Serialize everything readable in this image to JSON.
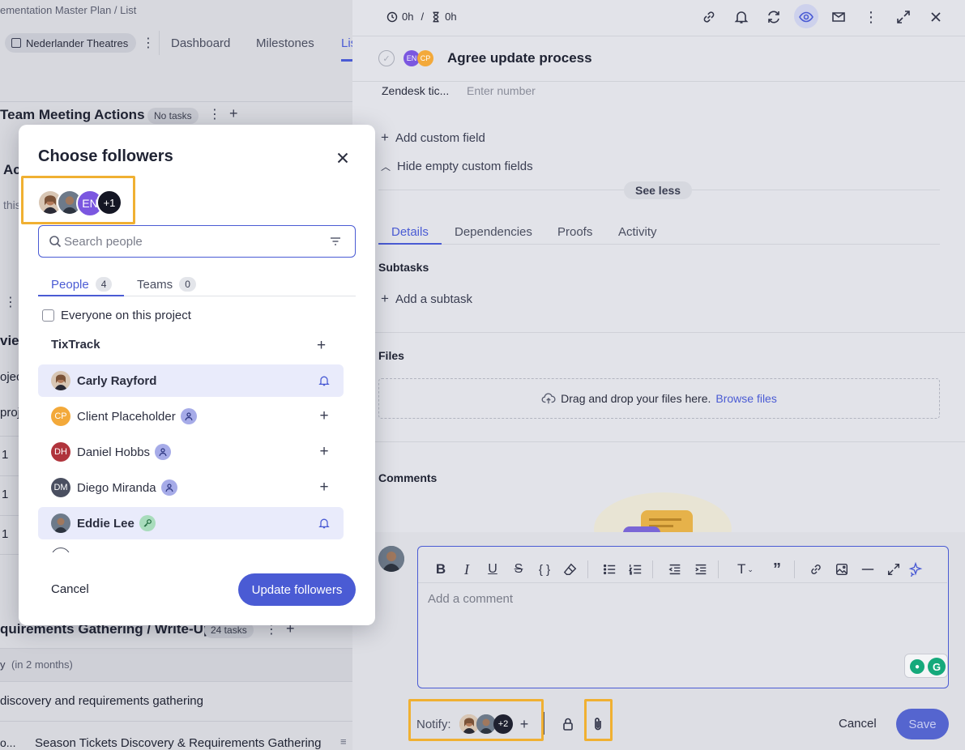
{
  "left_page": {
    "breadcrumb": "ementation Master Plan  /  List",
    "workspace": "Nederlander Theatres",
    "nav_tabs": [
      "Dashboard",
      "Milestones",
      "Lis"
    ],
    "section1_title": "Team Meeting Actions",
    "section1_badge": "No tasks",
    "partial_ac": "Ac",
    "partial_this": "this",
    "partial_view": "viev",
    "partial_ojec": "ojec",
    "partial_proj": "proj",
    "row_num1": "1",
    "row_num2": "1",
    "row_num3": "1",
    "section2_title": "quirements Gathering / Write-Up",
    "section2_badge": "24 tasks",
    "due_text": "y",
    "due_relative": "(in 2 months)",
    "task1": "discovery and requirements gathering",
    "task2_prefix": "o...",
    "task2": "Season Tickets Discovery & Requirements Gathering"
  },
  "right_panel": {
    "time_logged": "0h",
    "time_separator": "/",
    "time_estimate": "0h",
    "task_title": "Agree update process",
    "task_assignees": [
      "EN",
      "CP"
    ],
    "zendesk_label": "Zendesk tic...",
    "zendesk_placeholder": "Enter number",
    "add_custom_field": "Add custom field",
    "hide_empty_fields": "Hide empty custom fields",
    "see_less": "See less",
    "tabs": [
      "Details",
      "Dependencies",
      "Proofs",
      "Activity"
    ],
    "subtasks_heading": "Subtasks",
    "add_subtask": "Add a subtask",
    "files_heading": "Files",
    "dropzone_text": "Drag and drop your files here.",
    "browse_files": "Browse files",
    "comments_heading": "Comments",
    "comment_placeholder": "Add a comment",
    "notify_label": "Notify:",
    "notify_more": "+2",
    "cancel_label": "Cancel",
    "save_label": "Save"
  },
  "modal": {
    "title": "Choose followers",
    "selected_initials": "EN",
    "selected_more": "+1",
    "search_placeholder": "Search people",
    "tab_people": "People",
    "tab_people_count": "4",
    "tab_teams": "Teams",
    "tab_teams_count": "0",
    "everyone_label": "Everyone on this project",
    "group_name": "TixTrack",
    "people": [
      {
        "name": "Carly Rayford",
        "initials": "",
        "selected": true
      },
      {
        "name": "Client Placeholder",
        "initials": "CP",
        "selected": false
      },
      {
        "name": "Daniel Hobbs",
        "initials": "DH",
        "selected": false
      },
      {
        "name": "Diego Miranda",
        "initials": "DM",
        "selected": false
      },
      {
        "name": "Eddie Lee",
        "initials": "",
        "selected": true
      }
    ],
    "cancel_label": "Cancel",
    "update_label": "Update followers"
  },
  "colors": {
    "accent": "#4a5bd4",
    "highlight": "#f0b032",
    "en_avatar": "#7b57e0",
    "cp_avatar": "#f3a93a",
    "dh_avatar": "#b0343c",
    "dm_avatar": "#4a4f60"
  }
}
